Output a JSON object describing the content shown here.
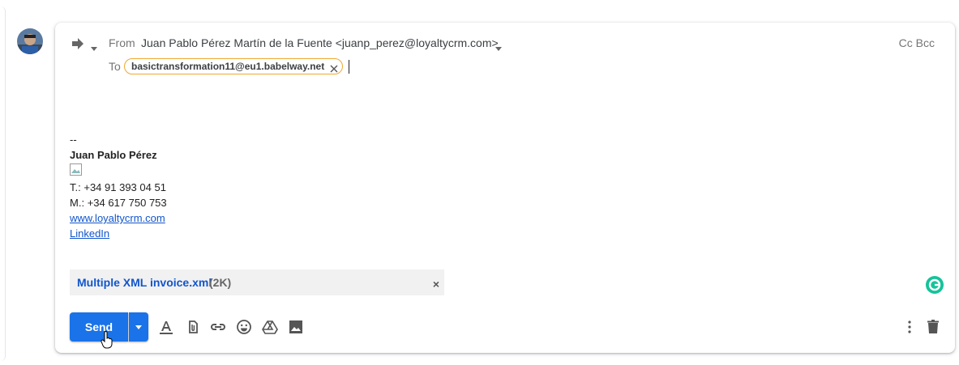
{
  "compose": {
    "from_label": "From",
    "from_value": "Juan Pablo Pérez Martín de la Fuente <juanp_perez@loyaltycrm.com>",
    "to_label": "To",
    "recipient": "basictransformation11@eu1.babelway.net",
    "cc_bcc": "Cc Bcc"
  },
  "signature": {
    "dashes": "--",
    "name": "Juan Pablo Pérez",
    "phone_label": "T.:",
    "phone": "+34 91 393 04 51",
    "mobile_label": "M.:",
    "mobile": "+34 617 750 753",
    "website": "www.loyaltycrm.com",
    "linkedin": "LinkedIn"
  },
  "attachment": {
    "name": "Multiple XML invoice.xml",
    "size": "(2K)",
    "remove": "×"
  },
  "toolbar": {
    "send_label": "Send"
  },
  "colors": {
    "send_blue": "#1a73e8",
    "chip_border": "#f0a830",
    "link": "#1155cc",
    "grammarly": "#15c39a"
  },
  "icons": [
    "reply-icon",
    "dropdown-caret-icon",
    "close-icon",
    "formatting-icon",
    "attach-icon",
    "link-icon",
    "emoji-icon",
    "drive-icon",
    "photo-icon",
    "more-options-icon",
    "trash-icon",
    "grammarly-icon",
    "hand-cursor-icon"
  ]
}
